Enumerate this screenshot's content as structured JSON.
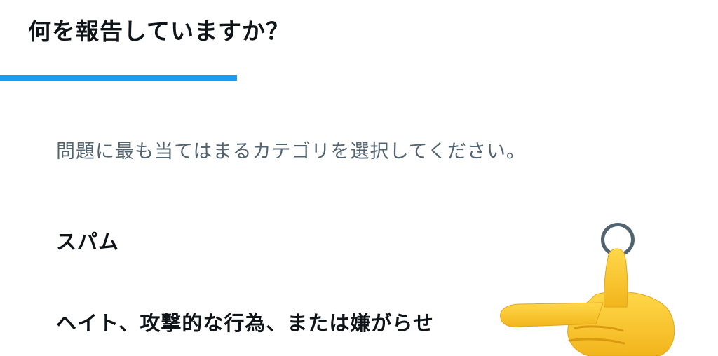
{
  "header": {
    "title": "何を報告していますか？"
  },
  "progress": {
    "fraction": 0.33
  },
  "main": {
    "instruction": "問題に最も当てはまるカテゴリを選択してください。",
    "options": [
      {
        "label": "スパム",
        "selected": false
      },
      {
        "label": "ヘイト、攻撃的な行為、または嫌がらせ",
        "selected": false
      }
    ]
  },
  "colors": {
    "accent": "#1d9bf0",
    "text_primary": "#0f1419",
    "text_secondary": "#536471"
  },
  "icons": {
    "overlay": "pointing-hand-icon",
    "radio": "radio-button-unchecked"
  }
}
